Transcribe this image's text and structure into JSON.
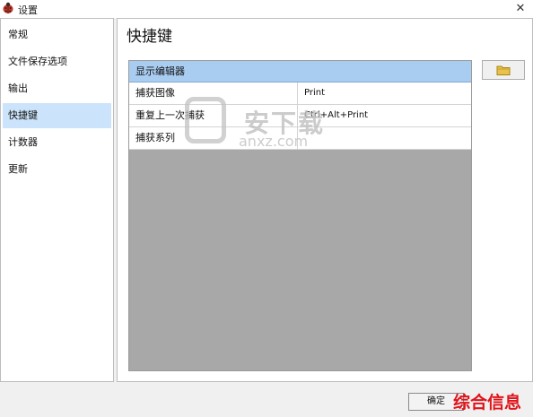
{
  "window": {
    "title": "设置",
    "close_symbol": "✕"
  },
  "sidebar": {
    "items": [
      {
        "label": "常规"
      },
      {
        "label": "文件保存选项"
      },
      {
        "label": "输出"
      },
      {
        "label": "快捷键"
      },
      {
        "label": "计数器"
      },
      {
        "label": "更新"
      }
    ],
    "selected": "快捷键"
  },
  "main": {
    "title": "快捷键",
    "shortcut_table": {
      "header": "显示编辑器",
      "rows": [
        {
          "action": "捕获图像",
          "key": "Print"
        },
        {
          "action": "重复上一次捕获",
          "key": "Ctrl+Alt+Print"
        },
        {
          "action": "捕获系列",
          "key": ""
        }
      ]
    },
    "folder_button_icon": "folder-icon"
  },
  "footer": {
    "ok_label": "确定"
  },
  "watermark": {
    "text": "安下载",
    "subtext": "anxz.com",
    "corner_text": "综合信息"
  },
  "colors": {
    "selected_bg": "#cce4fb",
    "header_bg": "#a9cdf1",
    "grid_bg": "#a8a8a8",
    "corner_watermark": "#e0141b"
  }
}
